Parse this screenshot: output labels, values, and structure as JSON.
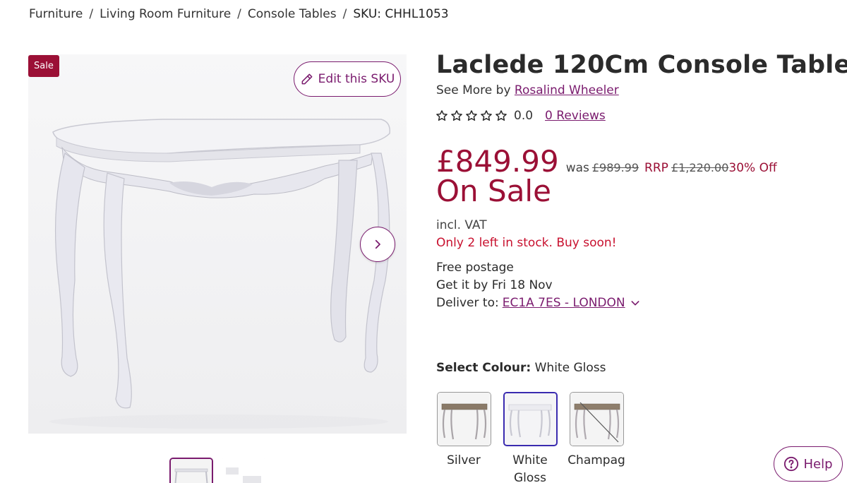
{
  "breadcrumb": {
    "items": [
      "Furniture",
      "Living Room Furniture",
      "Console Tables"
    ],
    "separator": "/",
    "sku": "SKU: CHHL1053"
  },
  "gallery": {
    "badge": "Sale",
    "edit_button": "Edit this SKU",
    "edit_icon": "pencil-icon",
    "next_icon": "chevron-right-icon",
    "thumbnails": 2,
    "active_thumbnail": 1
  },
  "product": {
    "title": "Laclede 120Cm Console Table",
    "see_more_prefix": "See More by",
    "brand": "Rosalind Wheeler",
    "rating_value": "0.0",
    "stars_filled": 0,
    "stars_total": 5,
    "reviews": "0 Reviews"
  },
  "pricing": {
    "price": "£849.99",
    "was_label": "was",
    "was_price": "£989.99",
    "rrp_label": "RRP",
    "rrp_price": "£1,220.00",
    "discount": "30% Off",
    "sale_text": "On Sale",
    "vat": "incl. VAT",
    "stock": "Only 2 left in stock. Buy soon!"
  },
  "delivery": {
    "postage": "Free postage",
    "get_it": "Get it by Fri 18 Nov",
    "deliver_label": "Deliver to:",
    "postcode": "EC1A 7ES - LONDON"
  },
  "colour": {
    "label": "Select Colour:",
    "selected": "White Gloss",
    "options": [
      {
        "name": "Silver"
      },
      {
        "name": "White Gloss"
      },
      {
        "name": "Champag"
      }
    ]
  },
  "help": {
    "label": "Help"
  },
  "colors": {
    "brand_purple": "#7a1b6e",
    "sale_red": "#9b1036",
    "stock_red": "#c8102e",
    "selected_swatch": "#3a2bb0"
  }
}
